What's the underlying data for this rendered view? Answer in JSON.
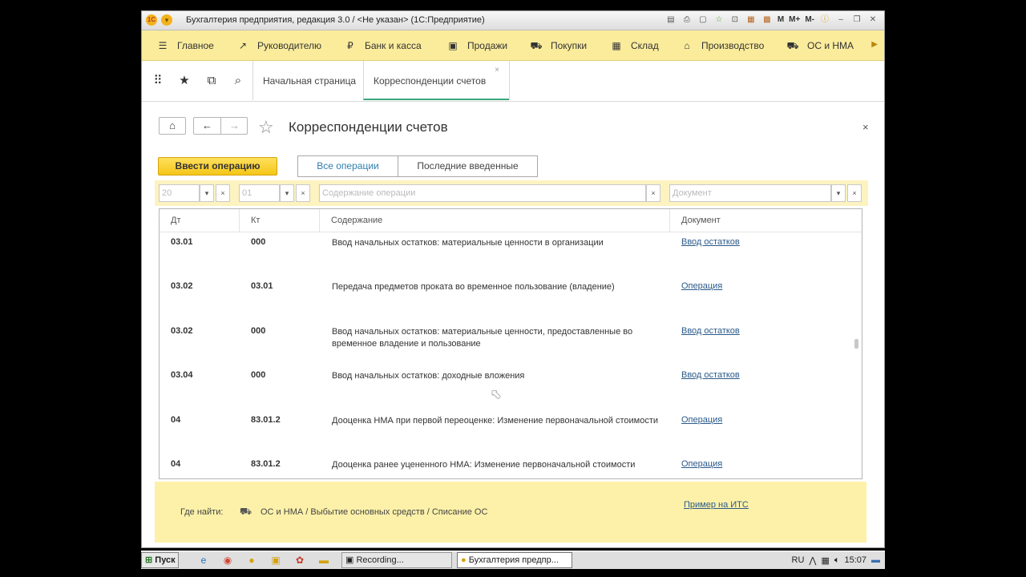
{
  "window": {
    "title": "Бухгалтерия предприятия, редакция 3.0 / <Не указан>  (1С:Предприятие)",
    "logo_text": "1С",
    "memory_buttons": [
      "M",
      "M+",
      "M-"
    ]
  },
  "sections": [
    {
      "label": "Главное",
      "icon": "menu-icon",
      "glyph": "☰"
    },
    {
      "label": "Руководителю",
      "icon": "trend-icon",
      "glyph": "↗"
    },
    {
      "label": "Банк и касса",
      "icon": "coin-icon",
      "glyph": "₽"
    },
    {
      "label": "Продажи",
      "icon": "bag-icon",
      "glyph": "▣"
    },
    {
      "label": "Покупки",
      "icon": "cart-icon",
      "glyph": "⛟"
    },
    {
      "label": "Склад",
      "icon": "warehouse-icon",
      "glyph": "▦"
    },
    {
      "label": "Производство",
      "icon": "factory-icon",
      "glyph": "⌂"
    },
    {
      "label": "ОС и НМА",
      "icon": "truck-icon",
      "glyph": "⛟"
    }
  ],
  "tabs": [
    {
      "label": "Начальная страница"
    },
    {
      "label": "Корреспонденции счетов",
      "close": "×"
    }
  ],
  "form": {
    "title": "Корреспонденции счетов",
    "close": "×",
    "primary_button": "Ввести операцию",
    "segments": [
      "Все операции",
      "Последние введенные"
    ]
  },
  "filters": {
    "dt_placeholder": "20",
    "kt_placeholder": "01",
    "content_placeholder": "Содержание операции",
    "document_placeholder": "Документ",
    "dropdown_glyph": "▾",
    "clear_glyph": "×"
  },
  "table": {
    "headers": [
      "Дт",
      "Кт",
      "Содержание",
      "Документ"
    ],
    "rows": [
      {
        "dt": "03.01",
        "kt": "000",
        "text": "Ввод начальных остатков: материальные ценности в организации",
        "doc": "Ввод остатков"
      },
      {
        "dt": "03.02",
        "kt": "03.01",
        "text": "Передача предметов проката во временное пользование (владение)",
        "doc": "Операция"
      },
      {
        "dt": "03.02",
        "kt": "000",
        "text": "Ввод начальных остатков: материальные ценности, предоставленные во временное владение и пользование",
        "doc": "Ввод остатков"
      },
      {
        "dt": "03.04",
        "kt": "000",
        "text": "Ввод начальных остатков: доходные вложения",
        "doc": "Ввод остатков"
      },
      {
        "dt": "04",
        "kt": "83.01.2",
        "text": "Дооценка НМА при первой переоценке: Изменение первоначальной стоимости",
        "doc": "Операция"
      },
      {
        "dt": "04",
        "kt": "83.01.2",
        "text": "Дооценка ранее уцененного НМА: Изменение первоначальной стоимости",
        "doc": "Операция"
      }
    ]
  },
  "footer": {
    "where_label": "Где найти:",
    "path": "ОС и НМА / Выбытие основных средств / Списание ОС",
    "its_link": "Пример на ИТС"
  },
  "taskbar": {
    "start": "Пуск",
    "tasks": [
      "Recording...",
      "Бухгалтерия предпр..."
    ],
    "lang": "RU",
    "time": "15:07"
  },
  "colors": {
    "section_bar": "#fbec9c",
    "accent_green": "#3aa87b",
    "link": "#2a5a8a",
    "primary_button": "#f5c518",
    "footer_bg": "#fdf1a9"
  }
}
